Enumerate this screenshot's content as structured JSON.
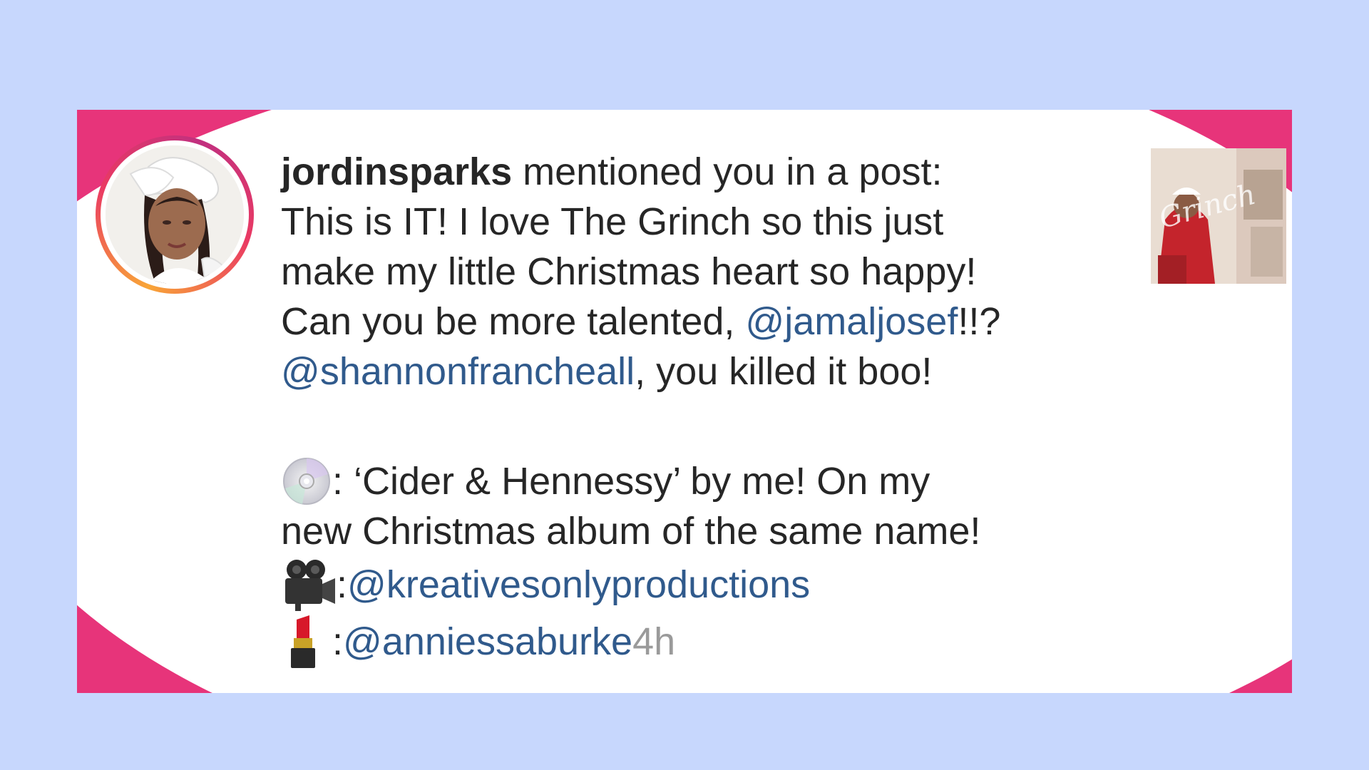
{
  "notification": {
    "username": "jordinsparks",
    "action": " mentioned you in a post:",
    "line1": "This is IT! I love The Grinch so this just",
    "line2": "make my little Christmas heart so happy!",
    "line3_before": "Can you be more talented, ",
    "mention1": "@jamaljosef",
    "line3_after": "!!?",
    "mention2": "@shannonfrancheall",
    "line4_after": ", you killed it boo!",
    "music_text": ": ‘Cider & Hennessy’ by me! On my",
    "music_text2": "new Christmas album of the same name!",
    "camera_sep": ": ",
    "mention3": "@kreativesonlyproductions",
    "lipstick_sep": ": ",
    "mention4": "@anniessaburke",
    "time": " 4h"
  },
  "icons": {
    "music": "cd-icon",
    "camera": "movie-camera-icon",
    "lipstick": "lipstick-icon"
  },
  "thumbnail": {
    "text": "Grinch"
  },
  "colors": {
    "background": "#c7d7fd",
    "accent_pink": "#e7347a",
    "mention_blue": "#305a8c",
    "time_gray": "#9a9a9a"
  }
}
